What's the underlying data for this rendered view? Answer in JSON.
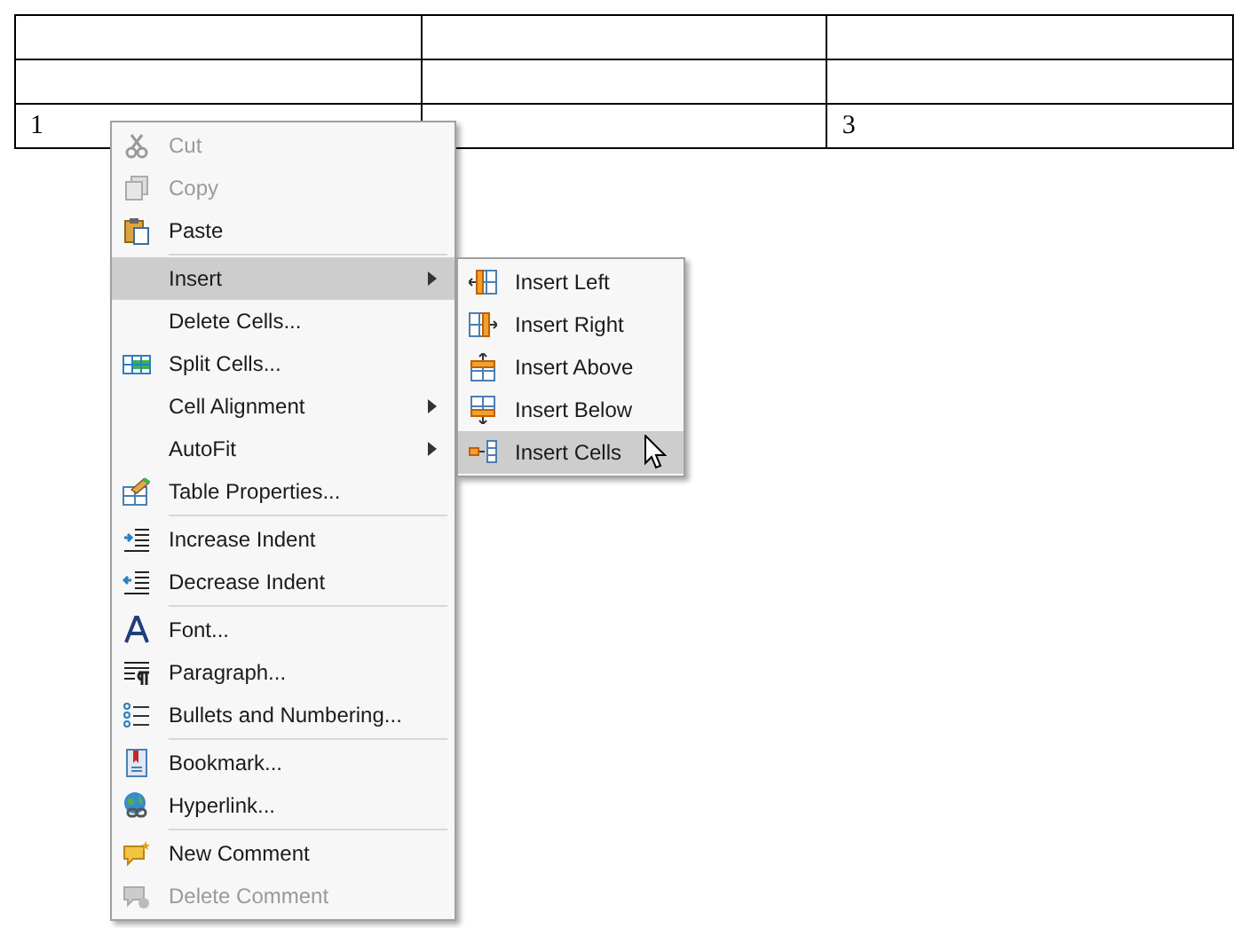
{
  "table": {
    "rows": [
      [
        "",
        "",
        ""
      ],
      [
        "",
        "",
        ""
      ],
      [
        "1",
        "",
        "3"
      ]
    ]
  },
  "context_menu": {
    "groups": [
      [
        {
          "label": "Cut",
          "disabled": true,
          "selected": false,
          "has_submenu": false
        },
        {
          "label": "Copy",
          "disabled": true,
          "selected": false,
          "has_submenu": false
        },
        {
          "label": "Paste",
          "disabled": false,
          "selected": false,
          "has_submenu": false
        }
      ],
      [
        {
          "label": "Insert",
          "disabled": false,
          "selected": true,
          "has_submenu": true
        },
        {
          "label": "Delete Cells...",
          "disabled": false,
          "selected": false,
          "has_submenu": false
        },
        {
          "label": "Split Cells...",
          "disabled": false,
          "selected": false,
          "has_submenu": false
        },
        {
          "label": "Cell Alignment",
          "disabled": false,
          "selected": false,
          "has_submenu": true
        },
        {
          "label": "AutoFit",
          "disabled": false,
          "selected": false,
          "has_submenu": true
        },
        {
          "label": "Table Properties...",
          "disabled": false,
          "selected": false,
          "has_submenu": false
        }
      ],
      [
        {
          "label": "Increase Indent",
          "disabled": false,
          "selected": false,
          "has_submenu": false
        },
        {
          "label": "Decrease Indent",
          "disabled": false,
          "selected": false,
          "has_submenu": false
        }
      ],
      [
        {
          "label": "Font...",
          "disabled": false,
          "selected": false,
          "has_submenu": false
        },
        {
          "label": "Paragraph...",
          "disabled": false,
          "selected": false,
          "has_submenu": false
        },
        {
          "label": "Bullets and Numbering...",
          "disabled": false,
          "selected": false,
          "has_submenu": false
        }
      ],
      [
        {
          "label": "Bookmark...",
          "disabled": false,
          "selected": false,
          "has_submenu": false
        },
        {
          "label": "Hyperlink...",
          "disabled": false,
          "selected": false,
          "has_submenu": false
        }
      ],
      [
        {
          "label": "New Comment",
          "disabled": false,
          "selected": false,
          "has_submenu": false
        },
        {
          "label": "Delete Comment",
          "disabled": true,
          "selected": false,
          "has_submenu": false
        }
      ]
    ]
  },
  "submenu": {
    "items": [
      {
        "label": "Insert Left",
        "selected": false
      },
      {
        "label": "Insert Right",
        "selected": false
      },
      {
        "label": "Insert Above",
        "selected": false
      },
      {
        "label": "Insert Below",
        "selected": false
      },
      {
        "label": "Insert Cells",
        "selected": true
      }
    ]
  }
}
